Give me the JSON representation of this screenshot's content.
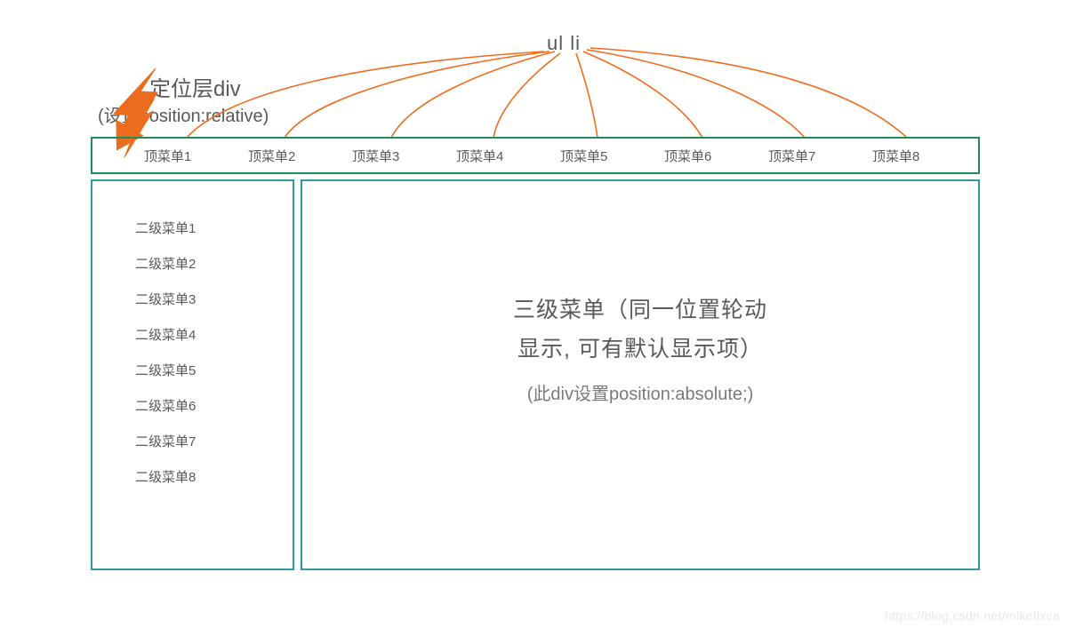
{
  "labels": {
    "ul_li": "ul li",
    "annotation_title": "定位层div",
    "annotation_sub": "(设置position:relative)"
  },
  "nav": {
    "items": [
      "顶菜单1",
      "顶菜单2",
      "顶菜单3",
      "顶菜单4",
      "顶菜单5",
      "顶菜单6",
      "顶菜单7",
      "顶菜单8"
    ]
  },
  "sidebar": {
    "items": [
      "二级菜单1",
      "二级菜单2",
      "二级菜单3",
      "二级菜单4",
      "二级菜单5",
      "二级菜单6",
      "二级菜单7",
      "二级菜单8"
    ]
  },
  "content": {
    "line1": "三级菜单（同一位置轮动",
    "line2": "显示, 可有默认显示项）",
    "note": "(此div设置position:absolute;)"
  },
  "watermark": "https://blog.csdn.net/mikeflxca"
}
